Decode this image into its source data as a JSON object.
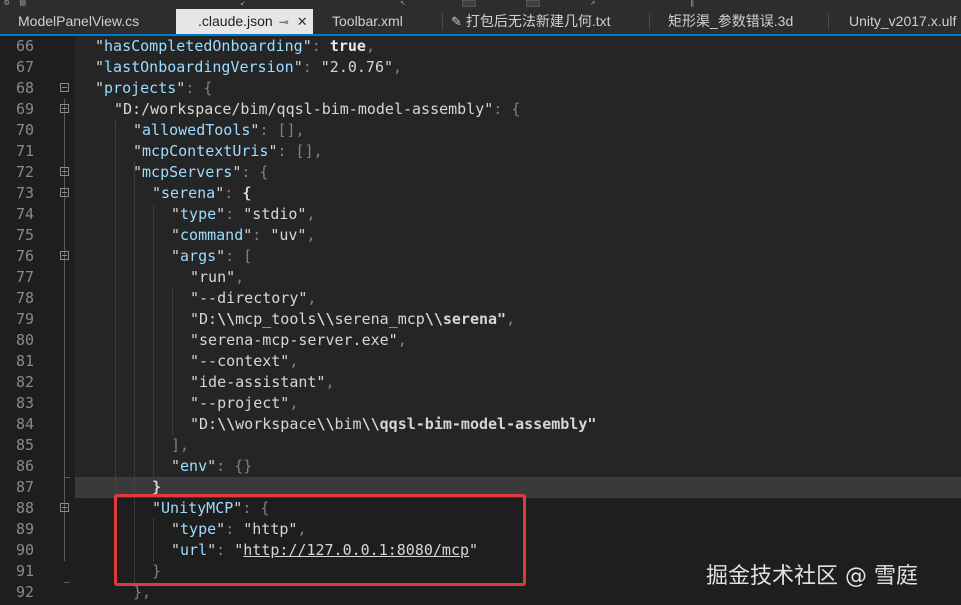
{
  "tabs": [
    {
      "label": "ModelPanelView.cs",
      "active": false
    },
    {
      "label": ".claude.json",
      "active": true
    },
    {
      "label": "Toolbar.xml",
      "active": false
    },
    {
      "label": "打包后无法新建几何.txt",
      "active": false
    },
    {
      "label": "矩形渠_参数错误.3d",
      "active": false
    },
    {
      "label": "Unity_v2017.x.ulf",
      "active": false
    }
  ],
  "lines": [
    {
      "n": "66",
      "t": [
        [
          "q",
          "\""
        ],
        [
          "k",
          "hasCompletedOnboarding"
        ],
        [
          "q",
          "\""
        ],
        [
          "pu",
          ": "
        ],
        [
          "kw",
          "true"
        ],
        [
          "pu",
          ","
        ]
      ]
    },
    {
      "n": "67",
      "t": [
        [
          "q",
          "\""
        ],
        [
          "k",
          "lastOnboardingVersion"
        ],
        [
          "q",
          "\""
        ],
        [
          "pu",
          ": "
        ],
        [
          "s",
          "\"2.0.76\""
        ],
        [
          "pu",
          ","
        ]
      ]
    },
    {
      "n": "68",
      "t": [
        [
          "q",
          "\""
        ],
        [
          "k",
          "projects"
        ],
        [
          "q",
          "\""
        ],
        [
          "pu",
          ": {"
        ]
      ]
    },
    {
      "n": "69",
      "t": [
        [
          "s",
          "\"D:/workspace/bim/qqsl-bim-model-assembly\""
        ],
        [
          "pu",
          ": {"
        ]
      ]
    },
    {
      "n": "70",
      "t": [
        [
          "q",
          "\""
        ],
        [
          "k",
          "allowedTools"
        ],
        [
          "q",
          "\""
        ],
        [
          "pu",
          ": [],"
        ]
      ]
    },
    {
      "n": "71",
      "t": [
        [
          "q",
          "\""
        ],
        [
          "k",
          "mcpContextUris"
        ],
        [
          "q",
          "\""
        ],
        [
          "pu",
          ": [],"
        ]
      ]
    },
    {
      "n": "72",
      "t": [
        [
          "q",
          "\""
        ],
        [
          "k",
          "mcpServers"
        ],
        [
          "q",
          "\""
        ],
        [
          "pu",
          ": {"
        ]
      ]
    },
    {
      "n": "73",
      "t": [
        [
          "q",
          "\""
        ],
        [
          "k",
          "serena"
        ],
        [
          "q",
          "\""
        ],
        [
          "pu",
          ": "
        ],
        [
          "br",
          "{"
        ]
      ]
    },
    {
      "n": "74",
      "t": [
        [
          "q",
          "\""
        ],
        [
          "k",
          "type"
        ],
        [
          "q",
          "\""
        ],
        [
          "pu",
          ": "
        ],
        [
          "s",
          "\"stdio\""
        ],
        [
          "pu",
          ","
        ]
      ]
    },
    {
      "n": "75",
      "t": [
        [
          "q",
          "\""
        ],
        [
          "k",
          "command"
        ],
        [
          "q",
          "\""
        ],
        [
          "pu",
          ": "
        ],
        [
          "s",
          "\"uv\""
        ],
        [
          "pu",
          ","
        ]
      ]
    },
    {
      "n": "76",
      "t": [
        [
          "q",
          "\""
        ],
        [
          "k",
          "args"
        ],
        [
          "q",
          "\""
        ],
        [
          "pu",
          ": ["
        ]
      ]
    },
    {
      "n": "77",
      "t": [
        [
          "s",
          "\"run\""
        ],
        [
          "pu",
          ","
        ]
      ]
    },
    {
      "n": "78",
      "t": [
        [
          "s",
          "\"--directory\""
        ],
        [
          "pu",
          ","
        ]
      ]
    },
    {
      "n": "79",
      "t": [
        [
          "s",
          "\"D:"
        ],
        [
          "s b",
          "\\\\"
        ],
        [
          "s",
          "mcp_tools"
        ],
        [
          "s b",
          "\\\\"
        ],
        [
          "s",
          "serena_mcp"
        ],
        [
          "s b",
          "\\\\serena\""
        ],
        [
          "pu",
          ","
        ]
      ]
    },
    {
      "n": "80",
      "t": [
        [
          "s",
          "\"serena-mcp-server.exe\""
        ],
        [
          "pu",
          ","
        ]
      ]
    },
    {
      "n": "81",
      "t": [
        [
          "s",
          "\"--context\""
        ],
        [
          "pu",
          ","
        ]
      ]
    },
    {
      "n": "82",
      "t": [
        [
          "s",
          "\"ide-assistant\""
        ],
        [
          "pu",
          ","
        ]
      ]
    },
    {
      "n": "83",
      "t": [
        [
          "s",
          "\"--project\""
        ],
        [
          "pu",
          ","
        ]
      ]
    },
    {
      "n": "84",
      "t": [
        [
          "s",
          "\"D:"
        ],
        [
          "s b",
          "\\\\"
        ],
        [
          "s",
          "workspace"
        ],
        [
          "s b",
          "\\\\"
        ],
        [
          "s",
          "bim"
        ],
        [
          "s b",
          "\\\\qqsl-bim-model-assembly\""
        ]
      ]
    },
    {
      "n": "85",
      "t": [
        [
          "pu",
          "],"
        ]
      ]
    },
    {
      "n": "86",
      "t": [
        [
          "q",
          "\""
        ],
        [
          "k",
          "env"
        ],
        [
          "q",
          "\""
        ],
        [
          "pu",
          ": {}"
        ]
      ]
    },
    {
      "n": "87",
      "t": [
        [
          "br",
          "}"
        ]
      ]
    },
    {
      "n": "88",
      "t": [
        [
          "q",
          "\""
        ],
        [
          "k",
          "UnityMCP"
        ],
        [
          "q",
          "\""
        ],
        [
          "pu",
          ": {"
        ]
      ]
    },
    {
      "n": "89",
      "t": [
        [
          "q",
          "\""
        ],
        [
          "k",
          "type"
        ],
        [
          "q",
          "\""
        ],
        [
          "pu",
          ": "
        ],
        [
          "s",
          "\"http\""
        ],
        [
          "pu",
          ","
        ]
      ]
    },
    {
      "n": "90",
      "t": [
        [
          "q",
          "\""
        ],
        [
          "k",
          "url"
        ],
        [
          "q",
          "\""
        ],
        [
          "pu",
          ": "
        ],
        [
          "s",
          "\""
        ],
        [
          "s u",
          "http://127.0.0.1:8080/mcp"
        ],
        [
          "s",
          "\""
        ]
      ]
    },
    {
      "n": "91",
      "t": [
        [
          "pu",
          "}"
        ]
      ]
    },
    {
      "n": "92",
      "t": [
        [
          "pu",
          "},"
        ]
      ]
    }
  ],
  "watermark": "掘金技术社区 @ 雪庭",
  "colors": {
    "background": "#1e1e1e",
    "accent": "#007acc",
    "highlight_box": "#e03a3a"
  }
}
